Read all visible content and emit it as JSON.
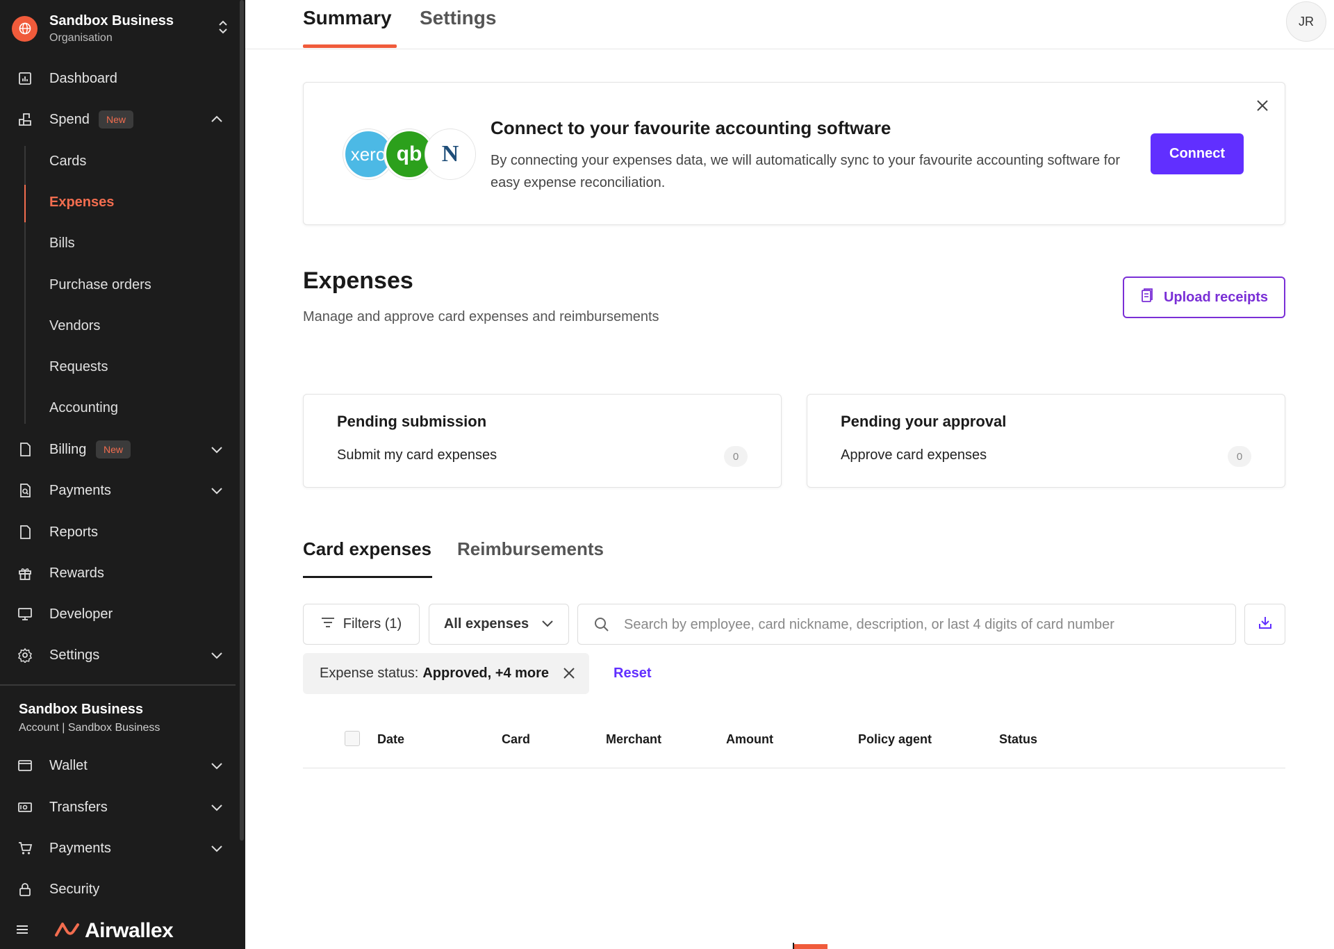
{
  "org": {
    "name": "Sandbox Business",
    "subtitle": "Organisation"
  },
  "nav": {
    "dashboard": "Dashboard",
    "spend": "Spend",
    "spend_badge": "New",
    "spend_items": [
      "Cards",
      "Expenses",
      "Bills",
      "Purchase orders",
      "Vendors",
      "Requests",
      "Accounting"
    ],
    "billing": "Billing",
    "billing_badge": "New",
    "payments": "Payments",
    "reports": "Reports",
    "rewards": "Rewards",
    "developer": "Developer",
    "settings": "Settings"
  },
  "account": {
    "name": "Sandbox Business",
    "subtitle": "Account | Sandbox Business"
  },
  "account_nav": {
    "wallet": "Wallet",
    "transfers": "Transfers",
    "payments": "Payments",
    "security": "Security"
  },
  "brand": {
    "name": "Airwallex"
  },
  "top_tabs": [
    "Summary",
    "Settings"
  ],
  "user": {
    "initials": "JR"
  },
  "banner": {
    "logo_xero": "xero",
    "logo_qb": "qb",
    "logo_netsuite": "N",
    "title": "Connect to your favourite accounting software",
    "description": "By connecting your expenses data, we will automatically sync to your favourite accounting software for easy expense reconciliation.",
    "connect_label": "Connect"
  },
  "expenses": {
    "title": "Expenses",
    "subtitle": "Manage and approve card expenses and reimbursements",
    "upload_label": "Upload receipts"
  },
  "pending": [
    {
      "title": "Pending submission",
      "action": "Submit my card expenses",
      "count": "0"
    },
    {
      "title": "Pending your approval",
      "action": "Approve card expenses",
      "count": "0"
    }
  ],
  "sub_tabs": [
    "Card expenses",
    "Reimbursements"
  ],
  "filters": {
    "filter_label": "Filters (1)",
    "all_expenses": "All expenses",
    "search_placeholder": "Search by employee, card nickname, description, or last 4 digits of card number",
    "chip_label": "Expense status:",
    "chip_value": "Approved, +4 more",
    "reset_label": "Reset"
  },
  "table_headers": [
    "Date",
    "Card",
    "Merchant",
    "Amount",
    "Policy agent",
    "Status"
  ],
  "colors": {
    "accent": "#f05b3b",
    "primary": "#612fff",
    "upload": "#7a2fd6",
    "sidebar": "#1c1c1c"
  }
}
